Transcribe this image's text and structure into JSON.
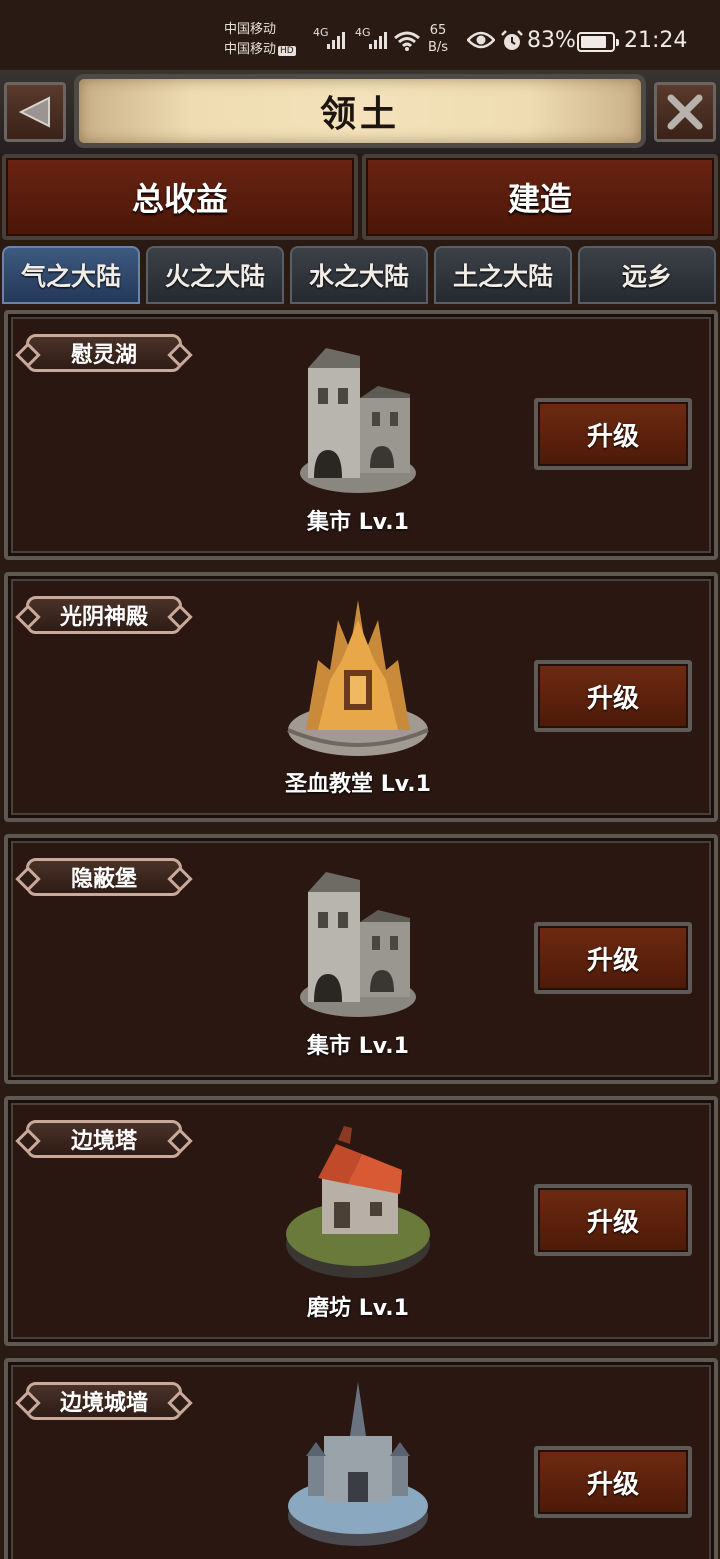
{
  "status_bar": {
    "carrier1": "中国移动",
    "carrier2": "中国移动",
    "hd": "HD",
    "net1": "4G",
    "net2": "4G",
    "speed_value": "65",
    "speed_unit": "B/s",
    "battery": "83%",
    "time": "21:24",
    "battery_level": 0.83
  },
  "header": {
    "title": "领土",
    "back_icon": "triangle-left-icon",
    "close_icon": "x-close-icon"
  },
  "actions": [
    {
      "label": "总收益"
    },
    {
      "label": "建造"
    }
  ],
  "continent_tabs": [
    {
      "label": "气之大陆",
      "active": true
    },
    {
      "label": "火之大陆",
      "active": false
    },
    {
      "label": "水之大陆",
      "active": false
    },
    {
      "label": "土之大陆",
      "active": false
    },
    {
      "label": "远乡",
      "active": false
    }
  ],
  "territories": [
    {
      "name": "慰灵湖",
      "building": "集市 Lv.1",
      "button": "升级",
      "icon": "market-building-icon"
    },
    {
      "name": "光阴神殿",
      "building": "圣血教堂 Lv.1",
      "button": "升级",
      "icon": "church-building-icon"
    },
    {
      "name": "隐蔽堡",
      "building": "集市 Lv.1",
      "button": "升级",
      "icon": "market-building-icon"
    },
    {
      "name": "边境塔",
      "building": "磨坊 Lv.1",
      "button": "升级",
      "icon": "mill-building-icon"
    },
    {
      "name": "边境城墙",
      "building": "",
      "button": "升级",
      "icon": "castle-building-icon"
    }
  ],
  "colors": {
    "background": "#2a1a14",
    "button_red": "#6a2412",
    "tab_active": "#3e5a80",
    "parchment": "#efdcb2"
  }
}
